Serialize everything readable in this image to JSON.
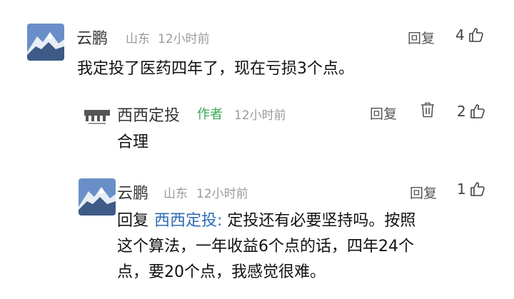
{
  "comments": [
    {
      "user": "云鹏",
      "location": "山东",
      "time": "12小时前",
      "reply_label": "回复",
      "likes": "4",
      "text": "我定投了医药四年了，现在亏损3个点。"
    },
    {
      "user": "西西定投",
      "author_tag": "作者",
      "time": "12小时前",
      "reply_label": "回复",
      "likes": "2",
      "text": "合理"
    },
    {
      "user": "云鹏",
      "location": "山东",
      "time": "12小时前",
      "reply_label": "回复",
      "likes": "1",
      "reply_prefix": "回复",
      "reply_target": "西西定投:",
      "text_lines": [
        " 定投还有必要坚持吗。按照",
        "这个算法，一年收益6个点的话，四年24个",
        "点，要20个点，我感觉很难。"
      ]
    }
  ],
  "colors": {
    "author_tag": "#3aa852",
    "reply_target": "#2b6bb3",
    "meta": "#9a9a9a"
  },
  "icons": {
    "like": "thumbs-up-icon",
    "delete": "trash-icon",
    "avatar_mountain": "snow-mountain-avatar",
    "avatar_author": "author-logo-avatar"
  }
}
